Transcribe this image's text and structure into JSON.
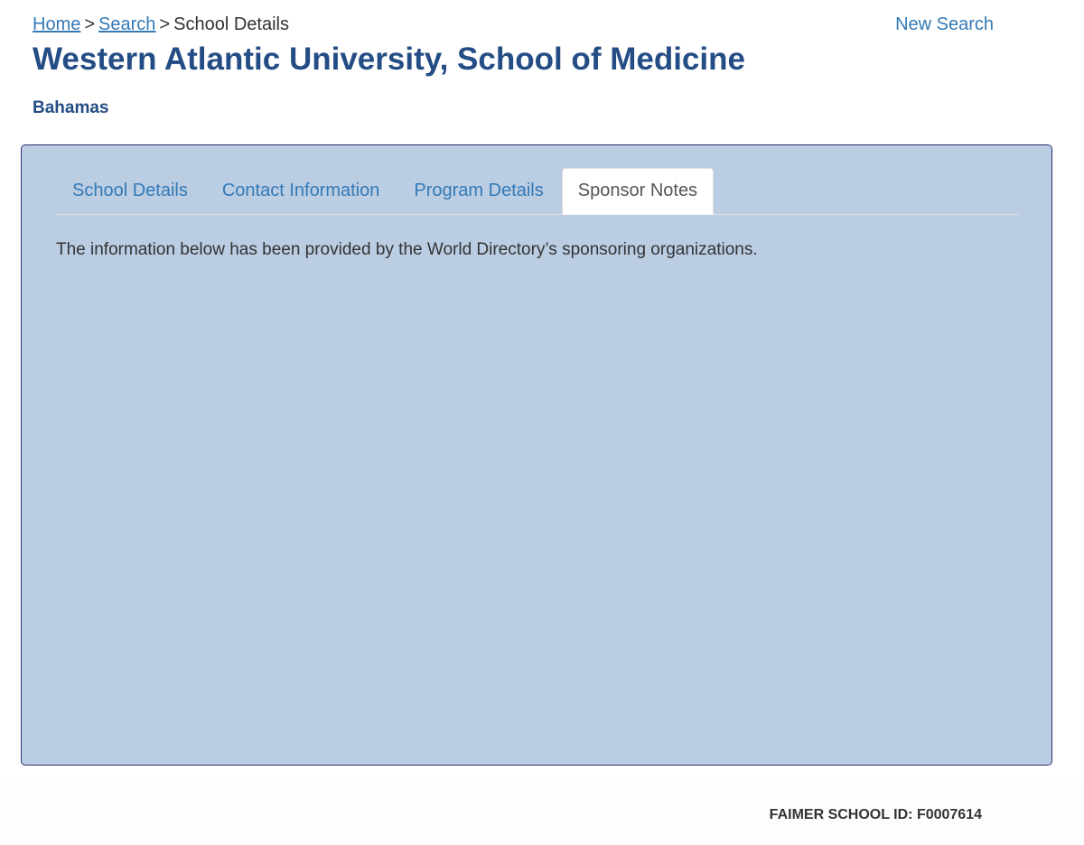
{
  "breadcrumb": {
    "home": "Home",
    "search": "Search",
    "current": "School Details",
    "separator": ">"
  },
  "header": {
    "new_search": "New Search",
    "title": "Western Atlantic University, School of Medicine",
    "country": "Bahamas"
  },
  "tabs": [
    {
      "label": "School Details",
      "active": false
    },
    {
      "label": "Contact Information",
      "active": false
    },
    {
      "label": "Program Details",
      "active": false
    },
    {
      "label": "Sponsor Notes",
      "active": true
    }
  ],
  "sponsor_notes": {
    "intro": "The information below has been provided by the World Directory’s sponsoring organizations."
  },
  "footer": {
    "school_id": "FAIMER SCHOOL ID: F0007614"
  },
  "colors": {
    "link": "#337ab7",
    "title": "#244d85",
    "panel_background": "#bacde3",
    "panel_border": "#2e2f6e"
  }
}
